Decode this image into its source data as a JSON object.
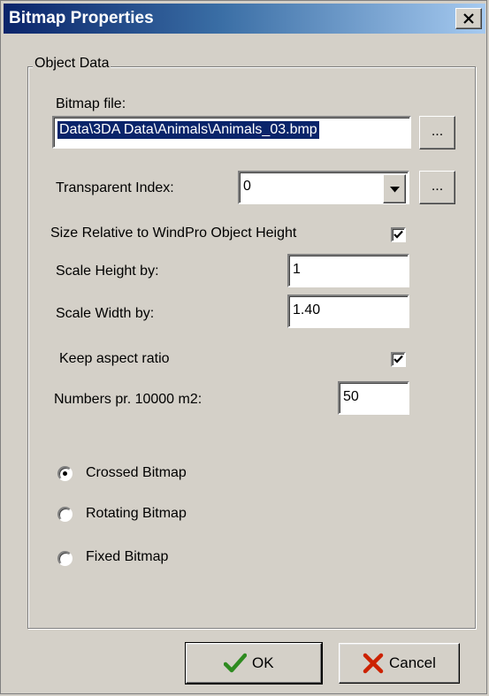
{
  "window": {
    "title": "Bitmap Properties"
  },
  "group": {
    "legend": "Object Data"
  },
  "bitmap_file": {
    "label": "Bitmap file:",
    "value": "Data\\3DA Data\\Animals\\Animals_03.bmp",
    "browse_label": "..."
  },
  "transparent_index": {
    "label": "Transparent Index:",
    "value": "0",
    "browse_label": "..."
  },
  "size_relative": {
    "label": "Size Relative to WindPro Object Height",
    "checked": true
  },
  "scale_height": {
    "label": "Scale Height by:",
    "value": "1"
  },
  "scale_width": {
    "label": "Scale Width by:",
    "value": "1.40"
  },
  "keep_aspect": {
    "label": "Keep aspect ratio",
    "checked": true
  },
  "numbers": {
    "label": "Numbers pr. 10000 m2:",
    "value": "50"
  },
  "bitmap_type": {
    "options": [
      {
        "label": "Crossed Bitmap",
        "selected": true
      },
      {
        "label": "Rotating Bitmap",
        "selected": false
      },
      {
        "label": "Fixed Bitmap",
        "selected": false
      }
    ]
  },
  "buttons": {
    "ok_label": "OK",
    "cancel_label": "Cancel"
  },
  "colors": {
    "title_start": "#0a246a",
    "title_end": "#a6caf0",
    "face": "#d4d0c8",
    "ok_icon": "#2e8b20",
    "cancel_icon": "#cc2200"
  }
}
